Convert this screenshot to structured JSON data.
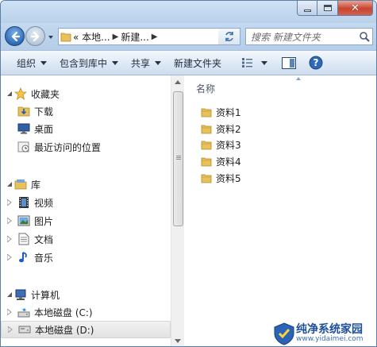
{
  "window": {
    "controls": {
      "minimize": "minimize",
      "maximize": "maximize",
      "close": "✕"
    }
  },
  "navigation": {
    "breadcrumb": [
      {
        "label": "« 本地..."
      },
      {
        "label": "新建..."
      }
    ],
    "search_placeholder": "搜索 新建文件夹"
  },
  "toolbar": {
    "organize": "组织",
    "include_in_library": "包含到库中",
    "share": "共享",
    "new_folder": "新建文件夹"
  },
  "nav_pane": {
    "favorites": {
      "label": "收藏夹",
      "items": [
        {
          "label": "下载",
          "icon": "download-folder-icon"
        },
        {
          "label": "桌面",
          "icon": "desktop-icon"
        },
        {
          "label": "最近访问的位置",
          "icon": "recent-places-icon"
        }
      ]
    },
    "libraries": {
      "label": "库",
      "items": [
        {
          "label": "视频",
          "icon": "video-library-icon"
        },
        {
          "label": "图片",
          "icon": "picture-library-icon"
        },
        {
          "label": "文档",
          "icon": "document-library-icon"
        },
        {
          "label": "音乐",
          "icon": "music-library-icon"
        }
      ]
    },
    "computer": {
      "label": "计算机",
      "items": [
        {
          "label": "本地磁盘 (C:)",
          "icon": "drive-c-icon"
        },
        {
          "label": "本地磁盘 (D:)",
          "icon": "drive-d-icon",
          "selected": true
        }
      ]
    }
  },
  "file_list": {
    "column_header": "名称",
    "items": [
      {
        "name": "资料1"
      },
      {
        "name": "资料2"
      },
      {
        "name": "资料3"
      },
      {
        "name": "资料4"
      },
      {
        "name": "资料5"
      }
    ]
  },
  "watermark": {
    "title": "纯净系统家园",
    "url": "www.yidaimei.com"
  },
  "colors": {
    "frame": "#bcd3ea",
    "accent": "#2e6bb8",
    "folder": "#e8c15a",
    "close_button": "#c8452f"
  }
}
